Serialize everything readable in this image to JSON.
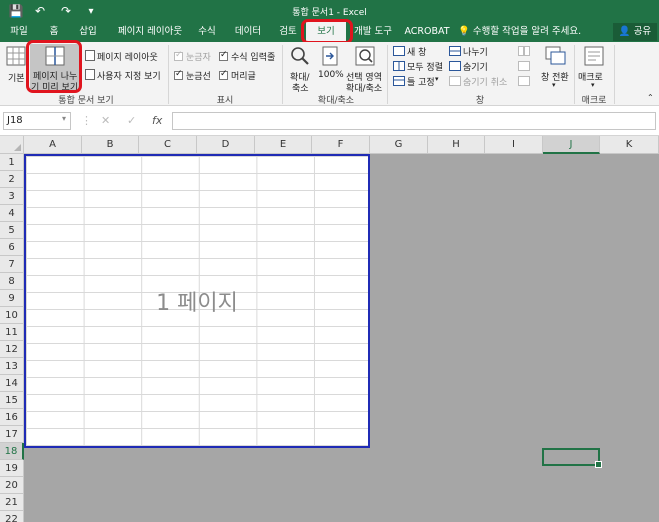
{
  "title": "통합 문서1 - Excel",
  "quick_access": {
    "save_icon": "💾",
    "undo_icon": "↶",
    "redo_icon": "↷",
    "customize_icon": "▾"
  },
  "tabs": [
    {
      "label": "파일"
    },
    {
      "label": "홈"
    },
    {
      "label": "삽입"
    },
    {
      "label": "페이지 레이아웃"
    },
    {
      "label": "수식"
    },
    {
      "label": "데이터"
    },
    {
      "label": "검토"
    },
    {
      "label": "보기"
    },
    {
      "label": "개발 도구"
    },
    {
      "label": "ACROBAT"
    }
  ],
  "tell_me": "수행할 작업을 알려 주세요.",
  "share": "공유",
  "ribbon": {
    "views": {
      "normal": "기본",
      "page_break_line1": "페이지 나누",
      "page_break_line2": "기 미리 보기",
      "page_layout": "페이지 레이아웃",
      "custom_views": "사용자 지정 보기",
      "group": "통합 문서 보기"
    },
    "show": {
      "ruler": "눈금자",
      "formula_bar": "수식 입력줄",
      "gridlines": "눈금선",
      "headings": "머리글",
      "group": "표시"
    },
    "zoom": {
      "zoom_line1": "확대/",
      "zoom_line2": "축소",
      "hundred": "100%",
      "selection_line1": "선택 영역",
      "selection_line2": "확대/축소",
      "group": "확대/축소"
    },
    "window": {
      "new_window": "새 창",
      "arrange_all": "모두 정렬",
      "freeze_panes": "틀 고정",
      "split": "나누기",
      "hide": "숨기기",
      "unhide": "숨기기 취소",
      "switch_line1": "창 전환",
      "group": "창"
    },
    "macros": {
      "label": "매크로",
      "group": "매크로"
    }
  },
  "formula_bar": {
    "name_box": "J18",
    "cancel": "✕",
    "enter": "✓",
    "fx": "fx"
  },
  "grid": {
    "columns": [
      "A",
      "B",
      "C",
      "D",
      "E",
      "F",
      "G",
      "H",
      "I",
      "J",
      "K"
    ],
    "rows": [
      "1",
      "2",
      "3",
      "4",
      "5",
      "6",
      "7",
      "8",
      "9",
      "10",
      "11",
      "12",
      "13",
      "14",
      "15",
      "16",
      "17",
      "18",
      "19",
      "20",
      "21",
      "22"
    ],
    "selected_column": "J",
    "selected_row": "18",
    "page_label": "1 페이지"
  },
  "colors": {
    "excel_green": "#217346",
    "page_border": "#1f2bb5",
    "highlight_red": "#e0141e"
  }
}
